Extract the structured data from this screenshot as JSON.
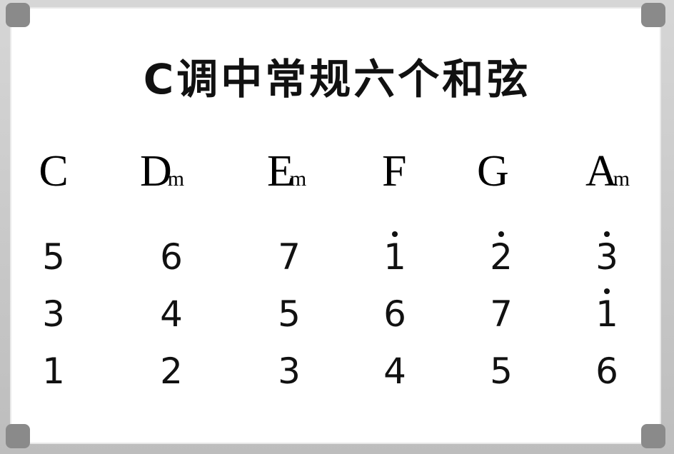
{
  "title": "C调中常规六个和弦",
  "chords": [
    {
      "root": "C",
      "suffix": ""
    },
    {
      "root": "D",
      "suffix": "m"
    },
    {
      "root": "E",
      "suffix": "m"
    },
    {
      "root": "F",
      "suffix": ""
    },
    {
      "root": "G",
      "suffix": ""
    },
    {
      "root": "A",
      "suffix": "m"
    }
  ],
  "rows": [
    [
      {
        "note": "5",
        "high": false
      },
      {
        "note": "6",
        "high": false
      },
      {
        "note": "7",
        "high": false
      },
      {
        "note": "1",
        "high": true
      },
      {
        "note": "2",
        "high": true
      },
      {
        "note": "3",
        "high": true
      }
    ],
    [
      {
        "note": "3",
        "high": false
      },
      {
        "note": "4",
        "high": false
      },
      {
        "note": "5",
        "high": false
      },
      {
        "note": "6",
        "high": false
      },
      {
        "note": "7",
        "high": false
      },
      {
        "note": "1",
        "high": true
      }
    ],
    [
      {
        "note": "1",
        "high": false
      },
      {
        "note": "2",
        "high": false
      },
      {
        "note": "3",
        "high": false
      },
      {
        "note": "4",
        "high": false
      },
      {
        "note": "5",
        "high": false
      },
      {
        "note": "6",
        "high": false
      }
    ]
  ]
}
